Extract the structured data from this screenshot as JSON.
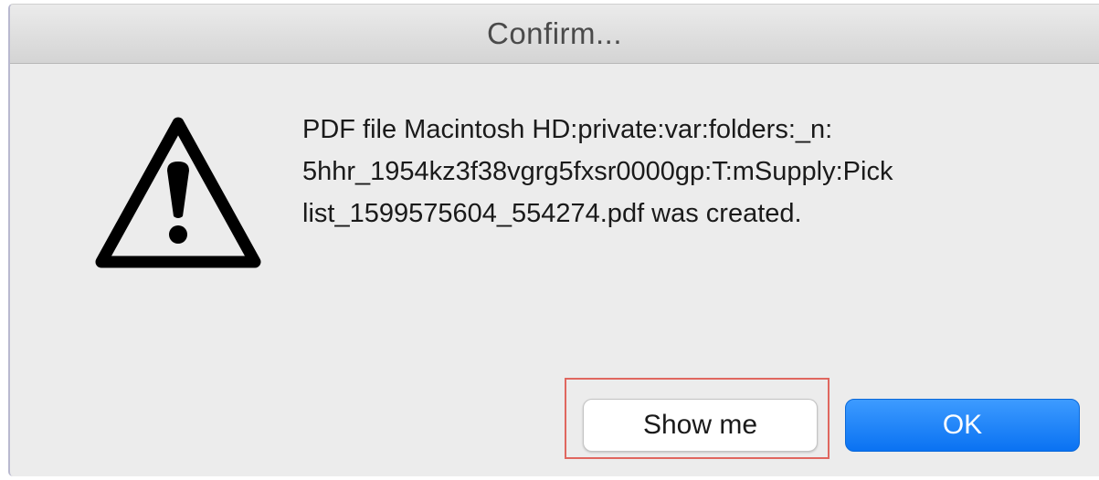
{
  "dialog": {
    "title": "Confirm...",
    "icon": "warning-triangle-icon",
    "message_lines": [
      "PDF file Macintosh HD:private:var:folders:_n:",
      "5hhr_1954kz3f38vgrg5fxsr0000gp:T:mSupply:Pick",
      "list_1599575604_554274.pdf was created."
    ],
    "buttons": {
      "show_me_label": "Show me",
      "ok_label": "OK"
    }
  },
  "colors": {
    "dialog_bg": "#ececec",
    "ok_button": "#0a72f2",
    "highlight_border": "#e0675f"
  }
}
